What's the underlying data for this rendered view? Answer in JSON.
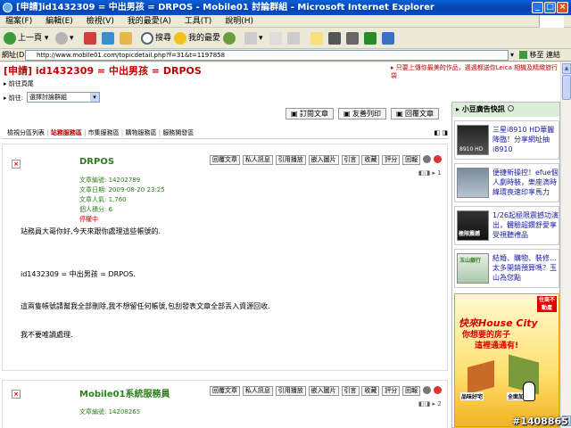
{
  "window": {
    "title": "[申請]id1432309 = 中出男孩 = DRPOS - Mobile01 討論群組 - Microsoft Internet Explorer"
  },
  "menu": [
    "檔案(F)",
    "編輯(E)",
    "檢視(V)",
    "我的最愛(A)",
    "工具(T)",
    "說明(H)"
  ],
  "toolbar": {
    "back": "上一頁",
    "search": "搜尋",
    "favorites": "我的最愛"
  },
  "address": {
    "label": "網址(D)",
    "url": "http://www.mobile01.com/topicdetail.php?f=31&t=1197858",
    "go": "移至",
    "links": "連結"
  },
  "header": {
    "title": "[申請] id1432309 = 中出男孩 = DRPOS",
    "notice": "只要上傳你最美的作品，週週都送你Leica 相機及精緻旅行袋",
    "back_home": "前往頁尾",
    "goto_label": "前往:",
    "goto_select": "選擇討論群組"
  },
  "actions": {
    "subscribe": "訂閱文章",
    "print": "友善列印",
    "reply": "回覆文章"
  },
  "tabs": [
    "檢視分區列表",
    "站務服務區",
    "市集服務區",
    "購物服務區",
    "服務開發區"
  ],
  "post_buttons": [
    "回覆文章",
    "私人訊息",
    "引用播放",
    "嵌入圖片",
    "引言",
    "收藏",
    "評分",
    "回報"
  ],
  "post1": {
    "author": "DRPOS",
    "meta": [
      "文章編號: 14202789",
      "文章日期: 2009-08-20 23:25",
      "文章人氣: 1,760",
      "個人積分: 6"
    ],
    "status": "停權中",
    "floor": "1",
    "body": [
      "站務員大哥你好,今天來跟你處理這些帳號的.",
      "id1432309 = 中出男孩 = DRPOS.",
      "這兩隻帳號請幫我全部刪除,我不想留任何帳號,包刮發表文章全部丟入資源回收.",
      "我不要唯讀處理."
    ]
  },
  "post2": {
    "author": "Mobile01系統服務員",
    "meta": [
      "文章編號: 14208265"
    ],
    "floor": "2"
  },
  "sidebar": {
    "title": "小豆廣告快訊",
    "ads": [
      {
        "text": "三星i8910 HD華麗降臨！分享網址抽i8910",
        "thumb_label": "8910 HD"
      },
      {
        "text": "便捷新操控！efue個人劇時裝，樂座滴時緯環喪速印享馬力",
        "thumb_label": ""
      },
      {
        "text": "1/26起極限震撼功演出，體驗超鑽舒愛享受視聽禮品",
        "thumb_label": "極限震撼"
      },
      {
        "text": "結婚、購物、裝修…太多開銷預算嗎？玉山為您點",
        "thumb_label": "玉山銀行"
      }
    ],
    "banner": {
      "title": "快來House City",
      "sub": "你想要的房子",
      "line": "這裡通通有!",
      "corner": "住商不動產",
      "tags": [
        "品味好宅",
        "全面加值"
      ]
    }
  },
  "watermark": "#1408865",
  "colors": {
    "titlebar": "#0443b0",
    "title_red": "#c00000",
    "author_green": "#2e7d1f",
    "sidebar_header": "#dceeda"
  }
}
